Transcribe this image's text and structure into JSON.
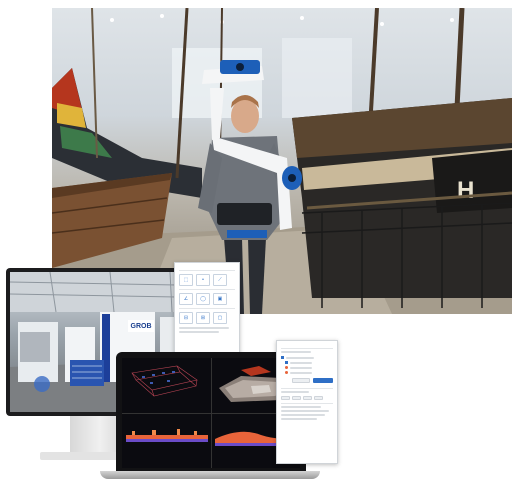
{
  "monitor": {
    "logo_text": "GROB"
  },
  "panels": {
    "measure": {
      "title": "",
      "sections": [],
      "icons": [
        "area-icon",
        "point-icon",
        "line-icon",
        "angle-icon",
        "circle-icon",
        "volume-icon"
      ]
    },
    "navigation": {
      "title": ""
    }
  },
  "colors": {
    "accent_blue": "#2f6fc6",
    "scanner_blue": "#1d5fb8",
    "harness_white": "#f4f5f6",
    "boat_red": "#b5361e",
    "pointcloud_orange": "#e8643a"
  }
}
